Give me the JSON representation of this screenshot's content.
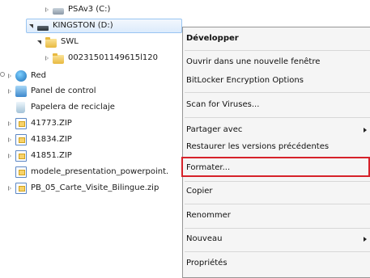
{
  "tree": {
    "items": [
      {
        "label": "PSAv3 (C:)",
        "icon": "drive-icon"
      },
      {
        "label": "KINGSTON (D:)",
        "icon": "usb-drive-icon"
      },
      {
        "label": "SWL",
        "icon": "folder-icon"
      },
      {
        "label": "00231501149615l120",
        "icon": "folder-icon"
      },
      {
        "label": "Red",
        "icon": "network-icon"
      },
      {
        "label": "Panel de control",
        "icon": "control-panel-icon"
      },
      {
        "label": "Papelera de reciclaje",
        "icon": "recycle-bin-icon"
      },
      {
        "label": "41773.ZIP",
        "icon": "zip-icon"
      },
      {
        "label": "41834.ZIP",
        "icon": "zip-icon"
      },
      {
        "label": "41851.ZIP",
        "icon": "zip-icon"
      },
      {
        "label": "modele_presentation_powerpoint.",
        "icon": "zip-icon"
      },
      {
        "label": "PB_05_Carte_Visite_Bilingue.zip",
        "icon": "zip-icon"
      }
    ]
  },
  "context_menu": {
    "items": [
      {
        "label": "Développer"
      },
      {
        "label": "Ouvrir dans une nouvelle fenêtre"
      },
      {
        "label": "BitLocker Encryption Options"
      },
      {
        "label": "Scan for Viruses..."
      },
      {
        "label": "Partager avec"
      },
      {
        "label": "Restaurer les versions précédentes"
      },
      {
        "label": "Formater..."
      },
      {
        "label": "Copier"
      },
      {
        "label": "Renommer"
      },
      {
        "label": "Nouveau"
      },
      {
        "label": "Propriétés"
      }
    ]
  },
  "colors": {
    "highlight_box": "#d6222a",
    "selection_border": "#99c5f2"
  }
}
